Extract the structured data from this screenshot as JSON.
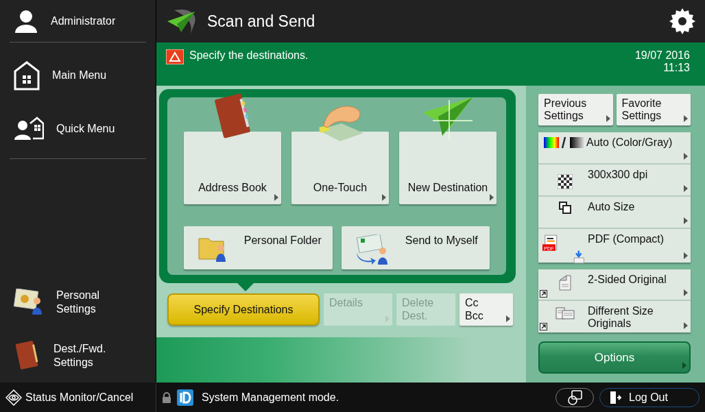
{
  "sidebar": {
    "user": {
      "label": "Administrator"
    },
    "menu": [
      {
        "label": "Main Menu"
      },
      {
        "label": "Quick Menu"
      }
    ],
    "shortcuts": [
      {
        "label": "Personal\nSettings"
      },
      {
        "label": "Dest./Fwd.\nSettings"
      }
    ],
    "status": {
      "label": "Status Monitor/Cancel"
    }
  },
  "header": {
    "title": "Scan and Send"
  },
  "message": {
    "text": "Specify the destinations.",
    "date": "19/07 2016",
    "time": "11:13"
  },
  "destinations": {
    "row_1": [
      {
        "label": "Address Book",
        "arrow": true
      },
      {
        "label": "One-Touch",
        "arrow": true
      },
      {
        "label": "New Destination",
        "arrow": true
      }
    ],
    "row_2": [
      {
        "label": "Personal Folder",
        "arrow": false
      },
      {
        "label": "Send to Myself",
        "arrow": false
      }
    ]
  },
  "actions": [
    {
      "label": "Specify Destinations",
      "kind": "primary",
      "disabled": false,
      "arrow": false
    },
    {
      "label": "Details",
      "kind": "plain",
      "disabled": true,
      "arrow": true
    },
    {
      "label": "Delete\nDest.",
      "kind": "plain",
      "disabled": true,
      "arrow": false
    },
    {
      "label": "Cc\nBcc",
      "kind": "plain",
      "disabled": false,
      "arrow": true
    }
  ],
  "settings": {
    "top": [
      {
        "label": "Previous\nSettings"
      },
      {
        "label": "Favorite\nSettings"
      }
    ],
    "groups": [
      {
        "rows": [
          {
            "label": "Auto (Color/Gray)",
            "shortcut": false
          },
          {
            "label": "300x300 dpi",
            "shortcut": false
          },
          {
            "label": "Auto Size",
            "shortcut": false
          },
          {
            "label": "PDF (Compact)",
            "shortcut": false,
            "badge": "PDF"
          }
        ]
      },
      {
        "rows": [
          {
            "label": "2-Sided Original",
            "shortcut": true
          },
          {
            "label": "Different Size\nOriginals",
            "shortcut": true
          }
        ]
      }
    ],
    "options": {
      "label": "Options"
    }
  },
  "footer": {
    "mode": "System Management mode.",
    "logout": "Log Out"
  }
}
